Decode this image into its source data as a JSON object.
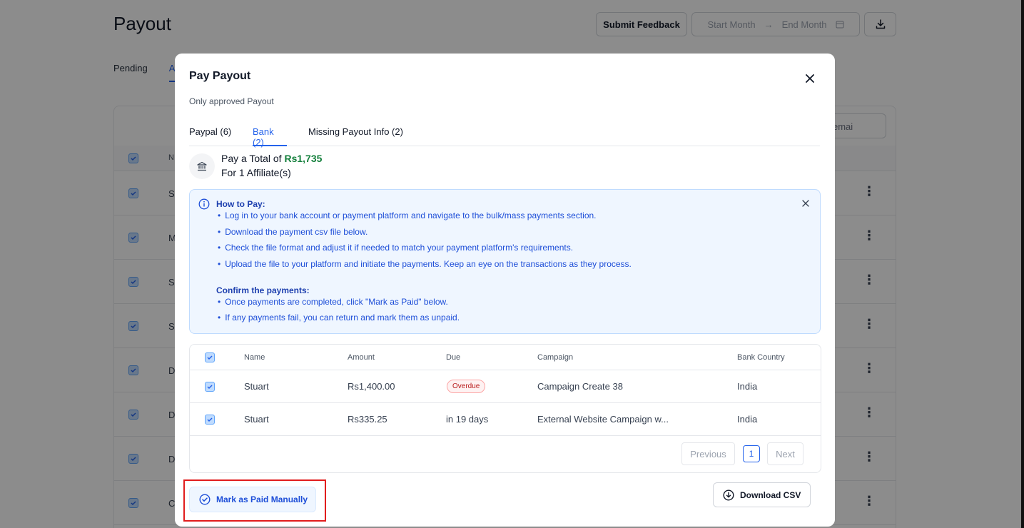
{
  "page": {
    "title": "Payout",
    "header": {
      "feedback_label": "Submit Feedback",
      "start_month_placeholder": "Start Month",
      "end_month_placeholder": "End Month",
      "arrow": "→"
    },
    "tabs": [
      "Pending",
      "A"
    ],
    "search_placeholder": "emai",
    "table_head_initial": "N",
    "row_initials": [
      "S",
      "M",
      "S",
      "S",
      "D",
      "D",
      "D",
      "C"
    ]
  },
  "modal": {
    "title": "Pay Payout",
    "subtitle": "Only approved Payout",
    "tabs": [
      {
        "label": "Paypal (6)"
      },
      {
        "label": "Bank (2)",
        "active": true
      },
      {
        "label": "Missing Payout Info (2)"
      }
    ],
    "total": {
      "prefix": "Pay a Total of ",
      "amount": "Rs1,735",
      "affiliates": "For 1 Affiliate(s)"
    },
    "how_to": {
      "heading": "How to Pay:",
      "steps": [
        "Log in to your bank account or payment platform and navigate to the bulk/mass payments section.",
        "Download the payment csv file below.",
        "Check the file format and adjust it if needed to match your payment platform's requirements.",
        "Upload the file to your platform and initiate the payments. Keep an eye on the transactions as they process."
      ],
      "confirm_heading": "Confirm the payments:",
      "confirm_steps": [
        "Once payments are completed, click \"Mark as Paid\" below.",
        "If any payments fail, you can return and mark them as unpaid."
      ]
    },
    "table": {
      "columns": [
        "Name",
        "Amount",
        "Due",
        "Campaign",
        "Bank Country"
      ],
      "rows": [
        {
          "name": "Stuart",
          "amount": "Rs1,400.00",
          "due": "Overdue",
          "campaign": "Campaign Create 38",
          "country": "India"
        },
        {
          "name": "Stuart",
          "amount": "Rs335.25",
          "due": "in 19 days",
          "campaign": "External Website Campaign w...",
          "country": "India"
        }
      ],
      "pager": {
        "previous": "Previous",
        "page": "1",
        "next": "Next"
      }
    },
    "buttons": {
      "mark_paid": "Mark as Paid Manually",
      "download_csv": "Download CSV"
    }
  },
  "colors": {
    "accent": "#2563eb",
    "amount_green": "#15803d",
    "overdue_red": "#b91c1c",
    "highlight_red": "#e11d1d"
  }
}
